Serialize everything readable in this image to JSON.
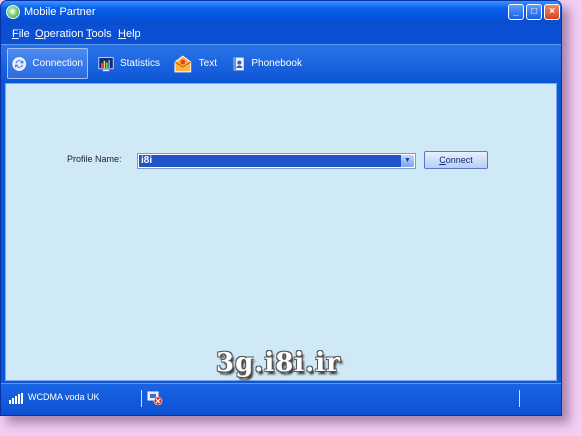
{
  "window": {
    "title": "Mobile Partner"
  },
  "title_buttons": {
    "minimize": "_",
    "maximize": "□",
    "close": "×"
  },
  "menu": [
    {
      "label_u": "F",
      "label_rest": "ile"
    },
    {
      "label_u": "O",
      "label_rest": "peration"
    },
    {
      "label_u": "T",
      "label_rest": "ools"
    },
    {
      "label_u": "H",
      "label_rest": "elp"
    }
  ],
  "toolbar": {
    "items": [
      {
        "label": "Connection",
        "icon": "connection-icon",
        "active": true
      },
      {
        "label": "Statistics",
        "icon": "statistics-icon",
        "active": false
      },
      {
        "label": "Text",
        "icon": "text-message-icon",
        "active": false
      },
      {
        "label": "Phonebook",
        "icon": "phonebook-icon",
        "active": false
      }
    ]
  },
  "main": {
    "profile_label": "Profile Name:",
    "profile_value": "i8i",
    "connect_u": "C",
    "connect_rest": "onnect",
    "watermark": "3g.i8i.ir"
  },
  "status": {
    "network": "WCDMA",
    "operator": "voda UK",
    "signal_icon": "signal-strength-icon",
    "connection_icon": "disconnected-icon"
  },
  "colors": {
    "titlebar": "#0553dd",
    "content_bg": "#cfe9f7",
    "selection": "#2154c8",
    "background": "#f2cdf2"
  }
}
